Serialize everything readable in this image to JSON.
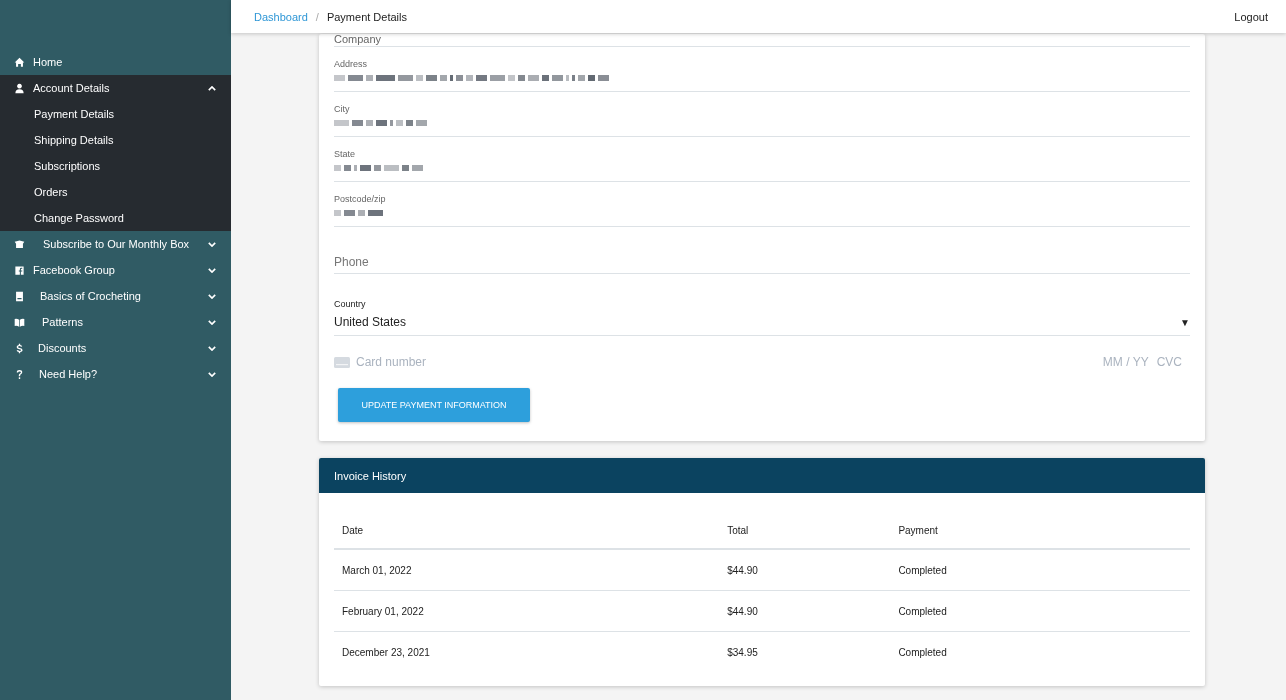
{
  "sidebar": {
    "items": [
      {
        "label": "Home",
        "expanded": false
      },
      {
        "label": "Account Details",
        "expanded": true,
        "children": [
          {
            "label": "Payment Details"
          },
          {
            "label": "Shipping Details"
          },
          {
            "label": "Subscriptions"
          },
          {
            "label": "Orders"
          },
          {
            "label": "Change Password"
          }
        ]
      },
      {
        "label": "Subscribe to Our Monthly Box",
        "expanded": false
      },
      {
        "label": "Facebook Group",
        "expanded": false
      },
      {
        "label": "Basics of Crocheting",
        "expanded": false
      },
      {
        "label": "Patterns",
        "expanded": false
      },
      {
        "label": "Discounts",
        "expanded": false
      },
      {
        "label": "Need Help?",
        "expanded": false
      }
    ]
  },
  "header": {
    "breadcrumbs": [
      {
        "label": "Dashboard",
        "link": true
      },
      {
        "label": "Payment Details",
        "link": false
      }
    ],
    "separator": "/",
    "logout": "Logout"
  },
  "payment_form": {
    "fields": [
      {
        "label": "Company",
        "kind": "cut"
      },
      {
        "label": "Address",
        "kind": "redacted"
      },
      {
        "label": "City",
        "kind": "redacted"
      },
      {
        "label": "State",
        "kind": "redacted"
      },
      {
        "label": "Postcode/zip",
        "kind": "redacted"
      },
      {
        "placeholder": "Phone",
        "kind": "input"
      },
      {
        "label": "Country",
        "value": "United States",
        "kind": "select",
        "caret": "▼"
      }
    ],
    "card": {
      "placeholder": "Card number",
      "expiry": "MM / YY",
      "cvc": "CVC"
    },
    "button": "UPDATE PAYMENT INFORMATION"
  },
  "invoice_history": {
    "title": "Invoice History",
    "columns": [
      "Date",
      "Total",
      "Payment"
    ],
    "rows": [
      [
        "March 01, 2022",
        "$44.90",
        "Completed"
      ],
      [
        "February 01, 2022",
        "$44.90",
        "Completed"
      ],
      [
        "December 23, 2021",
        "$34.95",
        "Completed"
      ]
    ]
  }
}
